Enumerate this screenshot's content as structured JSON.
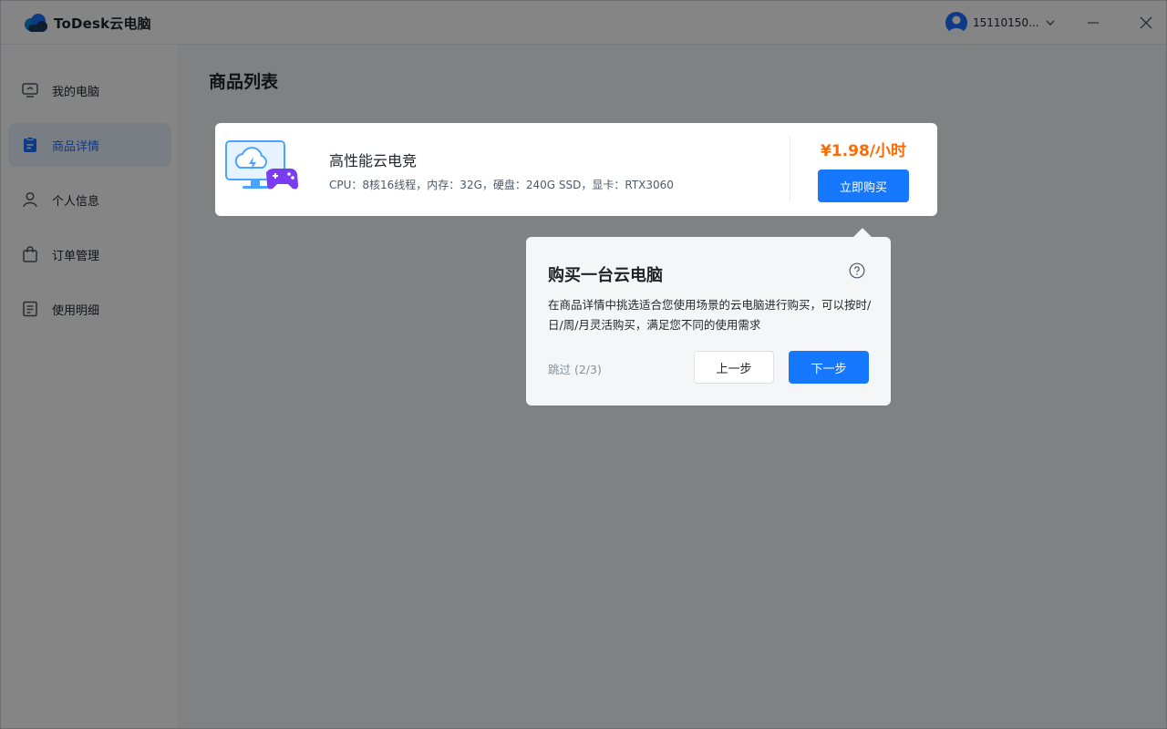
{
  "app": {
    "name": "ToDesk云电脑"
  },
  "account": {
    "name": "15110150..."
  },
  "sidebar": {
    "items": [
      {
        "label": "我的电脑",
        "icon": "monitor-icon"
      },
      {
        "label": "商品详情",
        "icon": "clipboard-icon",
        "active": true
      },
      {
        "label": "个人信息",
        "icon": "user-icon"
      },
      {
        "label": "订单管理",
        "icon": "shopping-bag-icon"
      },
      {
        "label": "使用明细",
        "icon": "receipt-icon"
      }
    ]
  },
  "main": {
    "title": "商品列表"
  },
  "product": {
    "name": "高性能云电竞",
    "spec": "CPU：8核16线程，内存：32G，硬盘：240G SSD，显卡：RTX3060",
    "price": "¥1.98/小时",
    "buy_label": "立即购买"
  },
  "guide": {
    "title": "购买一台云电脑",
    "description": "在商品详情中挑选适合您使用场景的云电脑进行购买，可以按时/日/周/月灵活购买，满足您不同的使用需求",
    "skip_label": "跳过 (2/3)",
    "prev_label": "上一步",
    "next_label": "下一步"
  },
  "colors": {
    "accent": "#1677ff",
    "price": "#ff6a00",
    "active_nav_bg": "#e8f1ff"
  }
}
